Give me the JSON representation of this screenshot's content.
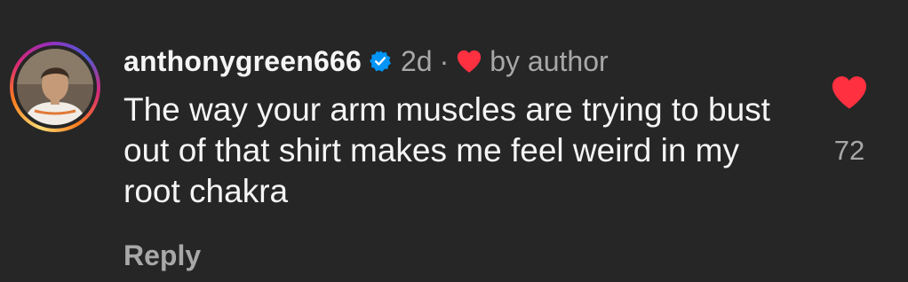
{
  "comment": {
    "username": "anthonygreen666",
    "timestamp": "2d",
    "separator": "·",
    "liked_by_author_label": "by author",
    "text": "The way your arm muscles are trying to bust out of that shirt makes me feel weird in my root chakra",
    "reply_label": "Reply",
    "like_count": "72",
    "avatar_icon": "profile-photo-avatar",
    "verified_icon": "verified-badge-icon",
    "liked_state": true
  },
  "colors": {
    "background": "#262626",
    "text_primary": "#f5f5f5",
    "text_secondary": "#a8a8a8",
    "heart_red": "#ff3040",
    "verified_blue": "#0095f6"
  }
}
